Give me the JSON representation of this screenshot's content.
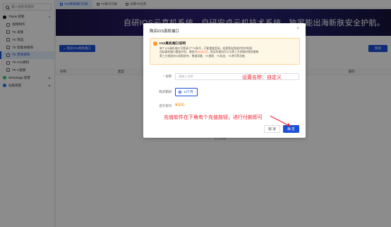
{
  "sidebar": {
    "search_placeholder": "输入搜索关键词",
    "items": [
      {
        "label": "Tiktok 获客",
        "icon": "tiktok-icon"
      },
      {
        "label": "视频制作",
        "icon": "video-icon"
      },
      {
        "label": "TK 采集",
        "icon": "collect-icon"
      },
      {
        "label": "TK 筛选",
        "icon": "filter-icon"
      },
      {
        "label": "TK 智能体矩阵",
        "icon": "matrix-icon"
      },
      {
        "label": "TK 苹果矩阵",
        "icon": "apple-icon"
      },
      {
        "label": "TK IOS真机",
        "icon": "phone-icon"
      },
      {
        "label": "TK A直播",
        "icon": "live-icon"
      },
      {
        "label": "Whatsapp 获客",
        "icon": "whatsapp-icon"
      },
      {
        "label": "拉筋获客",
        "icon": "facebook-icon"
      }
    ]
  },
  "tabs": [
    {
      "label": "IOS真机端口列表"
    },
    {
      "label": "TK账号列表"
    },
    {
      "label": "创建TK任务"
    }
  ],
  "banner": {
    "title": "自研IOS云真机系统，自研安卓云机技术系统，独家能出海新肤安全护航。"
  },
  "toolbar": {
    "buy_label": "购买IOS真机端口",
    "search_label": "搜索"
  },
  "table": {
    "headers": [
      "名称",
      "类型",
      "操作"
    ],
    "empty": "暂无数据"
  },
  "modal": {
    "title": "购买IOS真机端口",
    "close": "×",
    "notice": {
      "title": "IOS真机端口说明",
      "lines": [
        {
          "text": "每个IOS真机端口可登录2个TK账号，不能重复登录，短视频自我维护防护机制"
        },
        {
          "pre": "包括真机端口重复开机，增加为",
          "hl": "300元/月",
          "post": "，购买的真机可以与第三方获取的使用顺畅"
        },
        {
          "text": "第三方授权的IG视频发布、数据采集、TK提粉、TK私信、TK养号等功能"
        }
      ]
    },
    "name_label": "名称",
    "name_required": "*",
    "name_placeholder": "请输入名称",
    "name_hint": "设置名称：自定义",
    "period_label": "购买期间",
    "period_option": "12个月",
    "total_label": "合计支付",
    "total_value": "¥300",
    "recharge_hint": "充值软件在下角有个充值按钮，进行付款即可",
    "cancel_label": "取 消",
    "confirm_label": "确 定"
  },
  "colors": {
    "accent": "#1b4fd6",
    "warning": "#fa8c16",
    "hint": "#f5222d"
  }
}
